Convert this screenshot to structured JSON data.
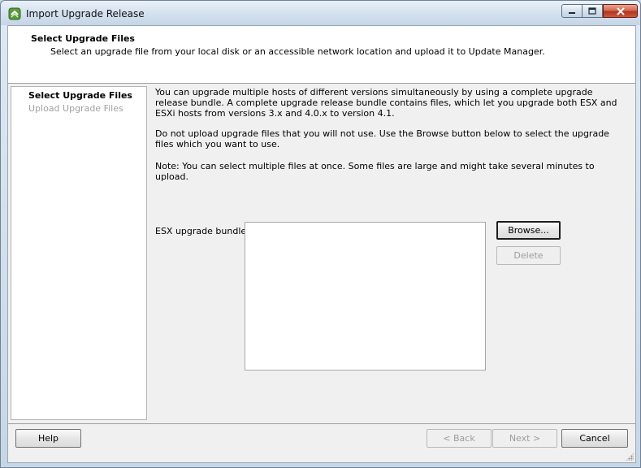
{
  "window": {
    "title": "Import Upgrade Release"
  },
  "header": {
    "title": "Select Upgrade Files",
    "subtitle": "Select an upgrade file from your local disk or an accessible network location and upload it to Update Manager."
  },
  "steps": [
    {
      "label": "Select Upgrade Files",
      "active": true
    },
    {
      "label": "Upload Upgrade Files",
      "active": false
    }
  ],
  "content": {
    "paragraph1": "You can upgrade multiple hosts of different versions simultaneously by using a complete upgrade release bundle. A complete upgrade release bundle contains files, which let you upgrade both ESX and ESXi hosts from versions 3.x and 4.0.x to version 4.1.",
    "paragraph2": "Do not upload upgrade files that you will not use. Use the Browse button below to select the upgrade files which you want to use.",
    "paragraph3": "Note: You can select multiple files at once. Some files are large and might take several minutes to upload.",
    "bundles_label": "ESX upgrade bundles:",
    "browse_label": "Browse...",
    "delete_label": "Delete"
  },
  "footer": {
    "help_label": "Help",
    "back_label": "< Back",
    "next_label": "Next >",
    "cancel_label": "Cancel"
  },
  "colors": {
    "titlebar": "#d3e0ee",
    "close_button": "#c75840",
    "disabled_text": "#9c9c9c"
  }
}
